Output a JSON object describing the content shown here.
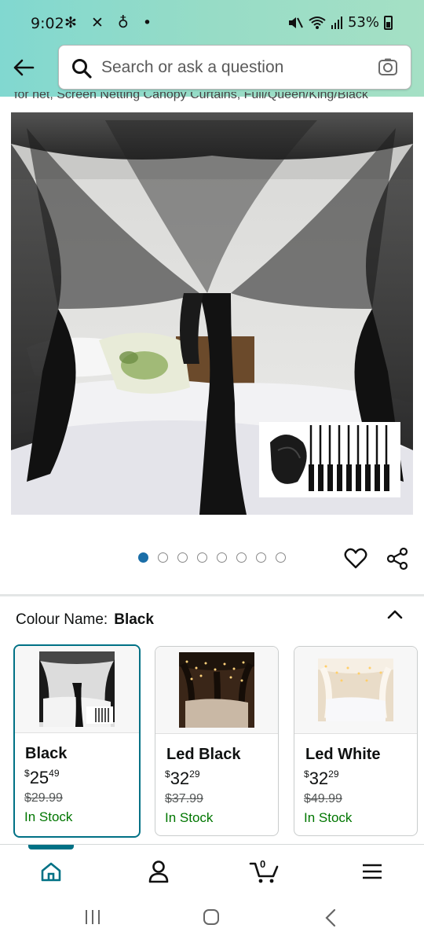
{
  "status_bar": {
    "time": "9:02",
    "left_icons": "✻ ✕ ♁ •",
    "battery": "53%"
  },
  "search": {
    "placeholder": "Search or ask a question"
  },
  "product": {
    "title_fragment": "for net, Screen Netting Canopy Curtains, Full/Queen/King/Black",
    "image_count": 8,
    "active_image": 1
  },
  "colour": {
    "label": "Colour Name:",
    "selected": "Black"
  },
  "variants": [
    {
      "name": "Black",
      "currency": "$",
      "price_whole": "25",
      "price_fraction": "49",
      "list_price": "$29.99",
      "stock": "In Stock",
      "selected": true
    },
    {
      "name": "Led Black",
      "currency": "$",
      "price_whole": "32",
      "price_fraction": "29",
      "list_price": "$37.99",
      "stock": "In Stock",
      "selected": false
    },
    {
      "name": "Led White",
      "currency": "$",
      "price_whole": "32",
      "price_fraction": "29",
      "list_price": "$49.99",
      "stock": "In Stock",
      "selected": false
    }
  ],
  "bottom_nav": {
    "cart_count": "0",
    "items": [
      "home-icon",
      "account-icon",
      "cart-icon",
      "menu-icon"
    ]
  },
  "colors": {
    "header_gradient_start": "#81d8d0",
    "header_gradient_end": "#a5e0c5",
    "selected_border": "#007185",
    "in_stock": "#007600",
    "active_dot": "#1a6ea8"
  }
}
